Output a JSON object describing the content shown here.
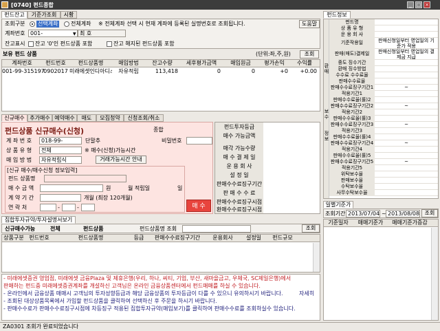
{
  "window": {
    "title": "[0740] 펀드종합"
  },
  "top_tabs": [
    {
      "label": "펀드잔고"
    },
    {
      "label": "기준가조회"
    },
    {
      "label": "시황"
    }
  ],
  "query": {
    "label": "조회구분",
    "opt_selected": "선택계좌",
    "opt_all": "전체계좌",
    "notice": "※ 전체계좌 선택 시 현재 계좌에 등록된 실명번호로 조회됩니다.",
    "help_button": "도움말",
    "account_label": "계좌번호",
    "account_value": "001-",
    "account_name": "최 호",
    "balance_label": "잔고표시",
    "chk1": "잔고 '0'인 펀드상품 포함",
    "chk2": "잔고 해지된 펀드상품 포함"
  },
  "holdings": {
    "title": "보유 펀드 상품",
    "unit": "(단위:좌,주,원)",
    "query_button": "조회",
    "columns": [
      "계좌번호",
      "펀드번호",
      "펀드상품명",
      "매입방법",
      "잔고수량",
      "세후평가금액",
      "매입원금",
      "평가손익",
      "수익률"
    ],
    "rows": [
      [
        "001-99-315197",
        "0902017",
        "미래에셋인디아디스",
        "자유적립",
        "113,418",
        "0",
        "0",
        "+0",
        "+0.00"
      ]
    ]
  },
  "mid_tabs": [
    {
      "label": "신규매수"
    },
    {
      "label": "추가매수"
    },
    {
      "label": "예약매수"
    },
    {
      "label": "매도"
    },
    {
      "label": "모집청약"
    },
    {
      "label": "신청조회/취소"
    }
  ],
  "order": {
    "title": "펀드상품 신규매수(신청)",
    "grade": "종합",
    "account_label": "계 좌 번 호",
    "account_value": "018-99-",
    "acct_suffix": "단말추",
    "password_label": "비밀번호",
    "type_label": "상 품 유 형",
    "type_value": "전체",
    "time_note": "※ 매수(신청)가능시간",
    "method_label": "매 입 방 법",
    "method_value": "자유적립식",
    "time_button": "거래가능시간 안내",
    "info_title": "[신규 매수/매수신청 정보입력]",
    "fund_label": "펀드 상품명",
    "amount_label": "매 수 금 액",
    "amount_unit": "원",
    "monthly_label": "월 적립일",
    "day_unit": "일",
    "period_label": "계 약 기 간",
    "period_unit": "개월 (최장 120개월)",
    "phone_label": "연 락 처",
    "dash": "-",
    "buy_button": "매 수"
  },
  "fund_detail_labels": [
    "펀드투자등급",
    "매수 가능금액",
    "매각 가능수량",
    "매 수 결 제 일",
    "운 용 회 사",
    "설 정 일",
    "판매수수료징구기간",
    "판 매 수 수 료",
    "판매수수료징구시점",
    "환매수수료징구시점"
  ],
  "invest_search": {
    "tab_label": "집합투자규약/투자설명서보기",
    "fund_label": "펀드상품명 조회",
    "query_button": "조회"
  },
  "lower_grid": {
    "header1": [
      "신규매수가능",
      "전체",
      "펀드상품"
    ],
    "columns": [
      "상품구분",
      "펀드번호",
      "펀드상품명",
      "등급",
      "판매수수료징구기간",
      "운용회사",
      "설정일",
      "펀드규모"
    ]
  },
  "notices": [
    "- 미래에셋증권 영업점, 미래에셋 금융Plaza 및 제휴은행(우리, 하나, 씨티, 기업, 부산, 새마을금고, 우체국, SC제일은행)에서",
    "  판매하는 펀드중 미래에셋증권계좌를 개설하신 고객님은 온라인 금융상품센터에서 펀드매매를 하실 수 있습니다.",
    "- 온라인에서 금융상품 매매시 고객님의 투자성향등급과 해당 금융상품의 투자등급이 다를 수 있으니 유의하시기 바랍니다.",
    "- 조회된 대상상품목록에서 가입할 펀드상품을 클릭하여 선택하신 후 주문을 하시기 바랍니다.",
    "- 판매수수료가 판매수수료징구시점에 차등징구 적용된 집합투자규약(매입보기)를 클릭하여 판매수수료를 조회하실수 있습니다."
  ],
  "notice_more": "자세히",
  "status": {
    "text": "ZA0301 조회가 완료되었습니다"
  },
  "right_info": {
    "tab": "펀드정보",
    "rows": [
      {
        "label": "펀드명",
        "value": ""
      },
      {
        "label": "상 품 유 형",
        "value": ""
      },
      {
        "label": "운 용 회 사",
        "value": ""
      },
      {
        "label": "기준작용일",
        "value": "판매신청일부터 영업일의 기준가 적용"
      },
      {
        "label": "판매(매도)결제일",
        "value": "판매신청일부터 영업일의 결제금 지급"
      },
      {
        "label": "중도 징수기간",
        "value": ""
      },
      {
        "label": "환매 징수방법",
        "value": ""
      },
      {
        "label": "수수료 수수료율",
        "value": ""
      },
      {
        "label": "판매수수료율",
        "value": ""
      },
      {
        "label": "판매수수료징구기간1",
        "value": "~"
      },
      {
        "label": "적용기간1",
        "value": ""
      },
      {
        "label": "판매수수료율(률)2",
        "value": ""
      },
      {
        "label": "판매수수료징구기간2",
        "value": "~"
      },
      {
        "label": "적용기간2",
        "value": ""
      },
      {
        "label": "판매수수료율(률)3",
        "value": ""
      },
      {
        "label": "판매수수료징구기간3",
        "value": "~"
      },
      {
        "label": "적용기간3",
        "value": ""
      },
      {
        "label": "판매수수료율(률)4",
        "value": ""
      },
      {
        "label": "판매수수료징구기간4",
        "value": "~"
      },
      {
        "label": "적용기간4",
        "value": ""
      },
      {
        "label": "판매수수료율(률)5",
        "value": ""
      },
      {
        "label": "판매수수료징구기간5",
        "value": "~"
      },
      {
        "label": "적용기간5",
        "value": ""
      },
      {
        "label": "위탁보수율",
        "value": ""
      },
      {
        "label": "판매보수율",
        "value": ""
      },
      {
        "label": "수탁보수율",
        "value": ""
      },
      {
        "label": "사무수탁보수율",
        "value": ""
      }
    ],
    "side_label_1": "환매",
    "side_label_2": "보수",
    "side_label_3": "정보"
  },
  "daily_price": {
    "tab": "일별기준가",
    "period_label": "조회기간",
    "from": "2013/07/04",
    "to": "2013/08/08",
    "query_button": "조회",
    "columns": [
      "기준일자",
      "매매기준가",
      "매매기준가증감"
    ]
  }
}
